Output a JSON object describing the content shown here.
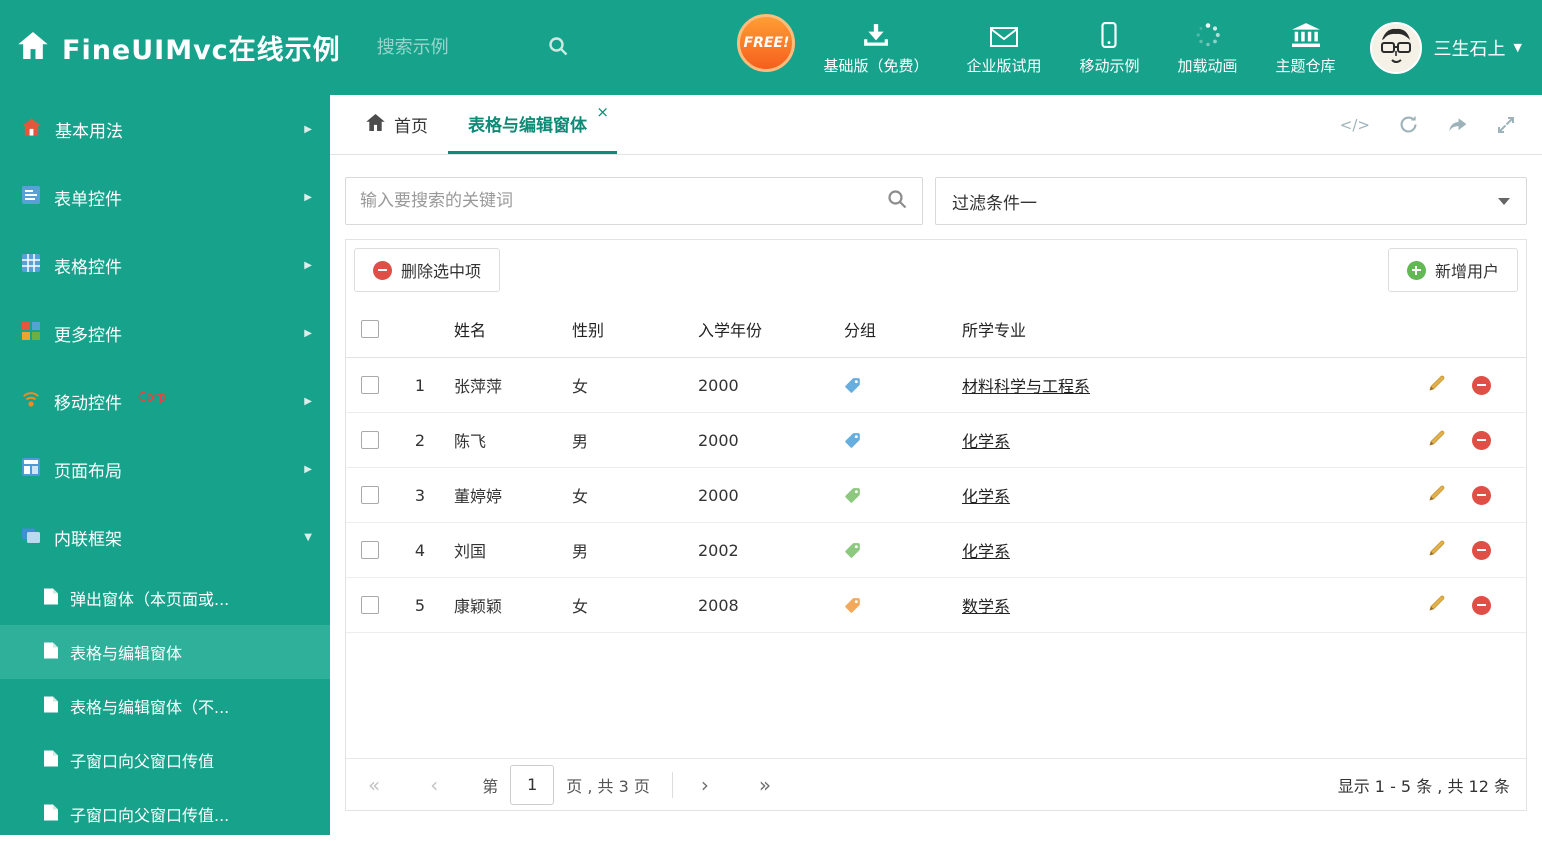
{
  "colors": {
    "teal": "#17a28c",
    "teal_dark": "#0e8a76",
    "teal_sel": "#2fb09b",
    "red": "#df4f45",
    "green": "#62b954",
    "pencil": "#dfae4a",
    "free_badge": "#f67020"
  },
  "glyphs": {
    "close": "×",
    "caret_down": "▼",
    "chevron_right": "▶",
    "chevron_down": "▼",
    "first": "«",
    "prev": "‹",
    "next": "›",
    "last": "»",
    "code": "</>"
  },
  "header": {
    "title": "FineUIMvc在线示例",
    "search_placeholder": "搜索示例",
    "free_badge": "FREE!",
    "nav": [
      {
        "label": "基础版（免费）"
      },
      {
        "label": "企业版试用"
      },
      {
        "label": "移动示例"
      },
      {
        "label": "加载动画"
      },
      {
        "label": "主题仓库"
      }
    ],
    "user_name": "三生石上"
  },
  "sidebar": {
    "items": [
      {
        "label": "基本用法"
      },
      {
        "label": "表单控件"
      },
      {
        "label": "表格控件"
      },
      {
        "label": "更多控件"
      },
      {
        "label": "移动控件",
        "badge": "Corp"
      },
      {
        "label": "页面布局"
      },
      {
        "label": "内联框架"
      }
    ],
    "subitems": [
      {
        "label": "弹出窗体（本页面或..."
      },
      {
        "label": "表格与编辑窗体"
      },
      {
        "label": "表格与编辑窗体（不..."
      },
      {
        "label": "子窗口向父窗口传值"
      },
      {
        "label": "子窗口向父窗口传值..."
      }
    ]
  },
  "tabs": {
    "home": "首页",
    "active": "表格与编辑窗体"
  },
  "filters": {
    "search_placeholder": "输入要搜索的关键词",
    "filter_value": "过滤条件一"
  },
  "toolbar": {
    "delete_label": "删除选中项",
    "add_label": "新增用户"
  },
  "table": {
    "headers": [
      "姓名",
      "性别",
      "入学年份",
      "分组",
      "所学专业"
    ],
    "rows": [
      {
        "num": "1",
        "name": "张萍萍",
        "gender": "女",
        "year": "2000",
        "tag_color": "#67aede",
        "major": "材料科学与工程系"
      },
      {
        "num": "2",
        "name": "陈飞",
        "gender": "男",
        "year": "2000",
        "tag_color": "#67aede",
        "major": "化学系"
      },
      {
        "num": "3",
        "name": "董婷婷",
        "gender": "女",
        "year": "2000",
        "tag_color": "#8cc87e",
        "major": "化学系"
      },
      {
        "num": "4",
        "name": "刘国",
        "gender": "男",
        "year": "2002",
        "tag_color": "#8cc87e",
        "major": "化学系"
      },
      {
        "num": "5",
        "name": "康颖颖",
        "gender": "女",
        "year": "2008",
        "tag_color": "#f2a95c",
        "major": "数学系"
      }
    ]
  },
  "pagination": {
    "page_prefix": "第",
    "current_page": "1",
    "page_suffix": "页 , 共 3 页",
    "summary": "显示 1 - 5 条 , 共 12 条"
  }
}
